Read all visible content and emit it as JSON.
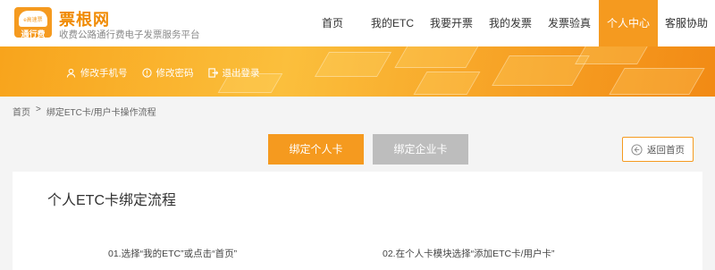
{
  "header": {
    "logo_cloud_text": "e高速票",
    "logo_sub": "通行费",
    "brand": "票根网",
    "tagline": "收费公路通行费电子发票服务平台"
  },
  "nav": [
    {
      "label": "首页",
      "active": false
    },
    {
      "label": "我的ETC",
      "active": false
    },
    {
      "label": "我要开票",
      "active": false
    },
    {
      "label": "我的发票",
      "active": false
    },
    {
      "label": "发票验真",
      "active": false
    },
    {
      "label": "个人中心",
      "active": true
    },
    {
      "label": "客服协助",
      "active": false
    }
  ],
  "user_links": {
    "change_phone": "修改手机号",
    "change_password": "修改密码",
    "logout": "退出登录"
  },
  "breadcrumb": {
    "home": "首页",
    "sep": ">",
    "current": "绑定ETC卡/用户卡操作流程"
  },
  "tabs": {
    "personal": "绑定个人卡",
    "company": "绑定企业卡"
  },
  "back_button": "返回首页",
  "section_title": "个人ETC卡绑定流程",
  "steps": {
    "step1": "01.选择“我的ETC”或点击“首页”",
    "step2": "02.在个人卡模块选择“添加ETC卡/用户卡”"
  },
  "colors": {
    "accent": "#f59a1f",
    "disabled": "#bdbdbd",
    "brand_text": "#f08a00"
  }
}
